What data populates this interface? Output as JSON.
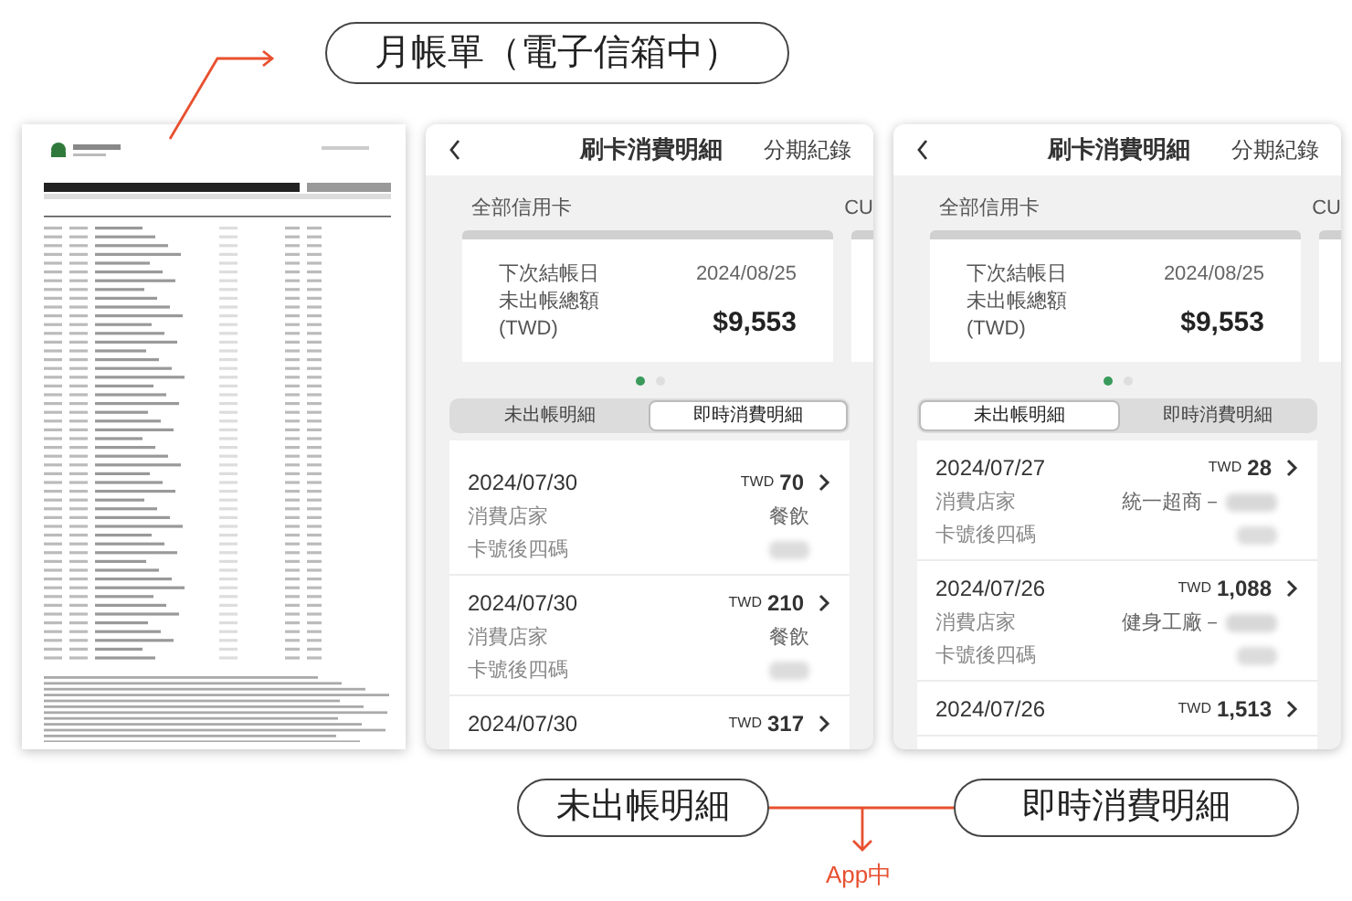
{
  "callouts": {
    "statement": "月帳單（電子信箱中）",
    "app_tabs": [
      "未出帳明細",
      "即時消費明細"
    ],
    "app_note": "App中"
  },
  "phones": [
    {
      "title": "刷卡消費明細",
      "action": "分期紀錄",
      "card_label": "全部信用卡",
      "next_card_label": "CU",
      "summary": {
        "closing_label": "下次結帳日",
        "closing_date": "2024/08/25",
        "amount_label": "未出帳總額",
        "currency_note": "(TWD)",
        "amount": "$9,553"
      },
      "pager": [
        {
          "selected": true
        },
        {
          "selected": false
        }
      ],
      "tabs": [
        {
          "label": "未出帳明細",
          "selected": false
        },
        {
          "label": "即時消費明細",
          "selected": true
        }
      ],
      "transactions": [
        {
          "date": "2024/07/30",
          "currency": "TWD",
          "amount": "70",
          "merchant_label": "消費店家",
          "merchant": "餐飲",
          "merchant_redacted": false,
          "card_label": "卡號後四碼"
        },
        {
          "date": "2024/07/30",
          "currency": "TWD",
          "amount": "210",
          "merchant_label": "消費店家",
          "merchant": "餐飲",
          "merchant_redacted": false,
          "card_label": "卡號後四碼"
        },
        {
          "date": "2024/07/30",
          "currency": "TWD",
          "amount": "317"
        }
      ]
    },
    {
      "title": "刷卡消費明細",
      "action": "分期紀錄",
      "card_label": "全部信用卡",
      "next_card_label": "CU",
      "summary": {
        "closing_label": "下次結帳日",
        "closing_date": "2024/08/25",
        "amount_label": "未出帳總額",
        "currency_note": "(TWD)",
        "amount": "$9,553"
      },
      "pager": [
        {
          "selected": true
        },
        {
          "selected": false
        }
      ],
      "tabs": [
        {
          "label": "未出帳明細",
          "selected": true
        },
        {
          "label": "即時消費明細",
          "selected": false
        }
      ],
      "transactions": [
        {
          "date": "2024/07/27",
          "currency": "TWD",
          "amount": "28",
          "merchant_label": "消費店家",
          "merchant": "統一超商－",
          "merchant_redacted": true,
          "card_label": "卡號後四碼"
        },
        {
          "date": "2024/07/26",
          "currency": "TWD",
          "amount": "1,088",
          "merchant_label": "消費店家",
          "merchant": "健身工廠－",
          "merchant_redacted": true,
          "card_label": "卡號後四碼"
        },
        {
          "date": "2024/07/26",
          "currency": "TWD",
          "amount": "1,513"
        }
      ]
    }
  ]
}
